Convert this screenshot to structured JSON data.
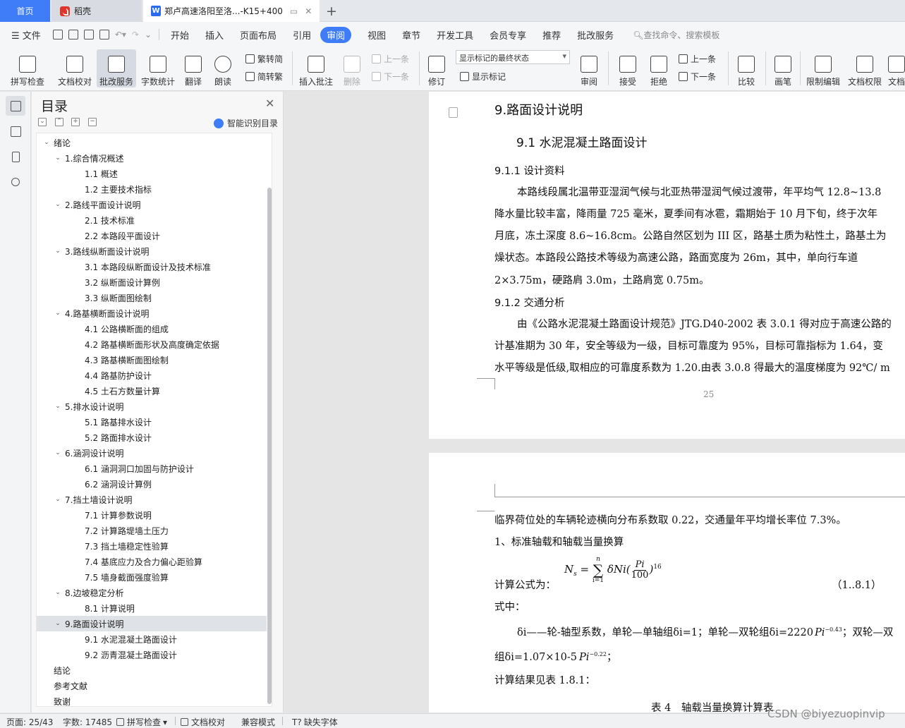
{
  "tabs": {
    "home": "首页",
    "dk": "稻壳",
    "doc": "郑卢高速洛阳至洛...-K15+400"
  },
  "menu": {
    "file": "文件",
    "items": [
      "开始",
      "插入",
      "页面布局",
      "引用",
      "审阅",
      "视图",
      "章节",
      "开发工具",
      "会员专享",
      "推荐",
      "批改服务"
    ],
    "active": "审阅",
    "search": "查找命令、搜索模板"
  },
  "ribbon": {
    "spell": "拼写检查",
    "proof": "文档校对",
    "review_service": "批改服务",
    "word_count": "字数统计",
    "translate": "翻译",
    "read_aloud": "朗读",
    "trad": "繁转简",
    "simp": "简转繁",
    "insert_comment": "插入批注",
    "delete": "删除",
    "prev": "上一条",
    "next": "下一条",
    "revise": "修订",
    "mark_select": "显示标记的最终状态",
    "show_marks": "显示标记",
    "review": "审阅",
    "accept": "接受",
    "reject": "拒绝",
    "prev2": "上一条",
    "next2": "下一条",
    "compare": "比较",
    "pen": "画笔",
    "restrict": "限制编辑",
    "doc_rights": "文档权限",
    "doc_more": "文档"
  },
  "toc": {
    "title": "目录",
    "smart": "智能识别目录",
    "items": [
      {
        "label": "绪论",
        "level": 0,
        "arrow": "⌄"
      },
      {
        "label": "1.综合情况概述",
        "level": 1,
        "arrow": "⌄"
      },
      {
        "label": "1.1 概述",
        "level": 2,
        "arrow": ""
      },
      {
        "label": "1.2 主要技术指标",
        "level": 2,
        "arrow": ""
      },
      {
        "label": "2.路线平面设计说明",
        "level": 1,
        "arrow": "⌄"
      },
      {
        "label": "2.1 技术标准",
        "level": 2,
        "arrow": ""
      },
      {
        "label": "2.2 本路段平面设计",
        "level": 2,
        "arrow": ""
      },
      {
        "label": "3.路线纵断面设计说明",
        "level": 1,
        "arrow": "⌄"
      },
      {
        "label": "3.1 本路段纵断面设计及技术标准",
        "level": 2,
        "arrow": ""
      },
      {
        "label": "3.2 纵断面设计算例",
        "level": 2,
        "arrow": ""
      },
      {
        "label": "3.3 纵断面图绘制",
        "level": 2,
        "arrow": ""
      },
      {
        "label": "4.路基横断面设计说明",
        "level": 1,
        "arrow": "⌄"
      },
      {
        "label": "4.1 公路横断面的组成",
        "level": 2,
        "arrow": ""
      },
      {
        "label": "4.2 路基横断面形状及高度确定依据",
        "level": 2,
        "arrow": ""
      },
      {
        "label": "4.3 路基横断面图绘制",
        "level": 2,
        "arrow": ""
      },
      {
        "label": "4.4 路基防护设计",
        "level": 2,
        "arrow": ""
      },
      {
        "label": "4.5 土石方数量计算",
        "level": 2,
        "arrow": ""
      },
      {
        "label": "5.排水设计说明",
        "level": 1,
        "arrow": "⌄"
      },
      {
        "label": "5.1 路基排水设计",
        "level": 2,
        "arrow": ""
      },
      {
        "label": "5.2 路面排水设计",
        "level": 2,
        "arrow": ""
      },
      {
        "label": "6.涵洞设计说明",
        "level": 1,
        "arrow": "⌄"
      },
      {
        "label": "6.1 涵洞洞口加固与防护设计",
        "level": 2,
        "arrow": ""
      },
      {
        "label": "6.2 涵洞设计算例",
        "level": 2,
        "arrow": ""
      },
      {
        "label": "7.挡土墙设计说明",
        "level": 1,
        "arrow": "⌄"
      },
      {
        "label": "7.1 计算参数说明",
        "level": 2,
        "arrow": ""
      },
      {
        "label": "7.2 计算路堤墙土压力",
        "level": 2,
        "arrow": ""
      },
      {
        "label": "7.3 挡土墙稳定性验算",
        "level": 2,
        "arrow": ""
      },
      {
        "label": "7.4 基底应力及合力偏心距验算",
        "level": 2,
        "arrow": ""
      },
      {
        "label": "7.5 墙身截面强度验算",
        "level": 2,
        "arrow": ""
      },
      {
        "label": "8.边坡稳定分析",
        "level": 1,
        "arrow": "⌄"
      },
      {
        "label": "8.1 计算说明",
        "level": 2,
        "arrow": ""
      },
      {
        "label": "9.路面设计说明",
        "level": 1,
        "arrow": "⌄",
        "selected": true
      },
      {
        "label": "9.1 水泥混凝土路面设计",
        "level": 2,
        "arrow": ""
      },
      {
        "label": "9.2 沥青混凝土路面设计",
        "level": 2,
        "arrow": ""
      },
      {
        "label": "结论",
        "level": 0,
        "arrow": ""
      },
      {
        "label": "参考文献",
        "level": 0,
        "arrow": ""
      },
      {
        "label": "致谢",
        "level": 0,
        "arrow": ""
      }
    ]
  },
  "doc": {
    "h1": "9.路面设计说明",
    "h2": "9.1  水泥混凝土路面设计",
    "h3a": "9.1.1  设计资料",
    "p1": [
      "本路线段属北温带亚湿润气候与北亚热带湿润气候过渡带，年平均气 12.8~13.8",
      "降水量比较丰富，降雨量 725 毫米，夏季间有冰雹，霜期始于 10 月下旬，终于次年",
      "月底，冻土深度 8.6~16.8cm。公路自然区划为 III 区，路基土质为粘性土，路基土为",
      "燥状态。本路段公路技术等级为高速公路，路面宽度为 26m，其中，单向行车道",
      "2×3.75m，硬路肩 3.0m，土路肩宽 0.75m。"
    ],
    "h3b": "9.1.2  交通分析",
    "p2": [
      "由《公路水泥混凝土路面设计规范》JTG.D40-2002 表 3.0.1 得对应于高速公路的",
      "计基准期为 30 年，安全等级为一级，目标可靠度为 95%，目标可靠指标为 1.64，变",
      "水平等级是低级,取相应的可靠度系数为 1.20.由表 3.0.8 得最大的温度梯度为 92℃/ m"
    ],
    "page_number": "25",
    "p3": "临界荷位处的车辆轮迹横向分布系数取 0.22，交通量年平均增长率位 7.3%。",
    "p4": "1、标准轴载和轴载当量换算",
    "formula_label": "计算公式为：",
    "formula_ns": "N",
    "formula_sub": "s",
    "formula_sum_top": "n",
    "formula_sum_bottom": "i=1",
    "formula_body": "δNi(",
    "formula_num": "Pi",
    "formula_den": "100",
    "formula_exp": "16",
    "formula_tag": "（1..8.1）",
    "p5": "式中：",
    "p6a": "δi——轮-轴型系数，单轮—单轴组δi=1；单轮—双轮组δi=2220",
    "p6_pi": "Pi",
    "p6_exp": "−0.43",
    "p6b": "；双轮—双",
    "p7a": "组δi=1.07×10-5",
    "p7_pi": "Pi",
    "p7_exp": "−0.22",
    "p7b": "；",
    "p8": "计算结果见表 1.8.1：",
    "table_caption": "表 4　轴载当量换算计算表"
  },
  "status": {
    "page": "页面: 25/43",
    "words": "字数: 17485",
    "spell": "拼写检查",
    "proof": "文档校对",
    "compat": "兼容模式",
    "missing_font": "缺失字体"
  },
  "watermark": "CSDN @biyezuopinvip"
}
